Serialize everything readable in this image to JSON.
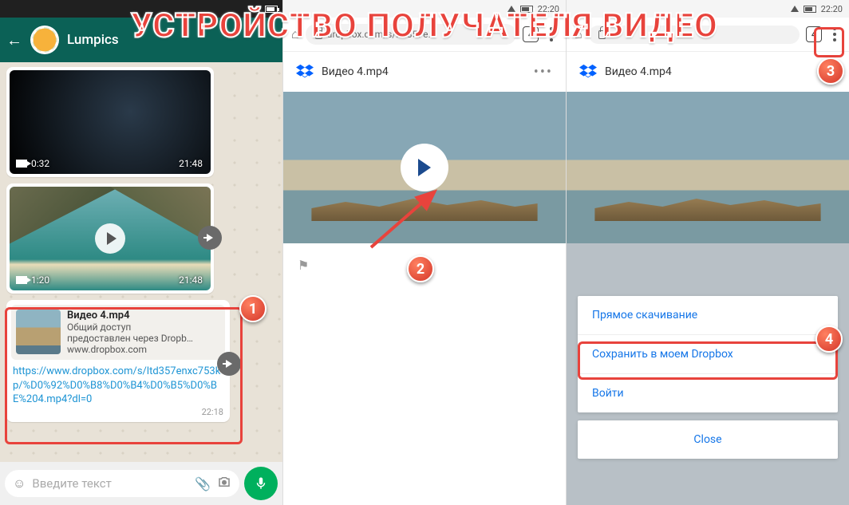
{
  "overlay_title": "УСТРОЙСТВО ПОЛУЧАТЕЛЯ ВИДЕО",
  "callouts": {
    "c1": "1",
    "c2": "2",
    "c3": "3",
    "c4": "4"
  },
  "panel1": {
    "contact_name": "Lumpics",
    "vid1": {
      "duration": "0:32",
      "time": "21:48"
    },
    "vid2": {
      "duration": "1:20",
      "time": "21:48"
    },
    "link": {
      "title": "Видео 4.mp4",
      "desc1": "Общий доступ",
      "desc2": "предоставлен через Dropb…",
      "domain": "www.dropbox.com",
      "url": "https://www.dropbox.com/s/ltd357enxc753kp/%D0%92%D0%B8%D0%B4%D0%B5%D0%BE%204.mp4?dl=0",
      "time": "22:18"
    },
    "input_placeholder": "Введите текст"
  },
  "panel2": {
    "status_time": "22:20",
    "tab_count": "4",
    "url_display": "dropbox.com/s/ltd357e…",
    "file_title": "Видео 4.mp4"
  },
  "panel3": {
    "status_time": "22:20",
    "tab_count": "4",
    "file_title": "Видео 4.mp4",
    "menu": {
      "direct": "Прямое скачивание",
      "save": "Сохранить в моем Dropbox",
      "login": "Войти",
      "close": "Close"
    }
  }
}
